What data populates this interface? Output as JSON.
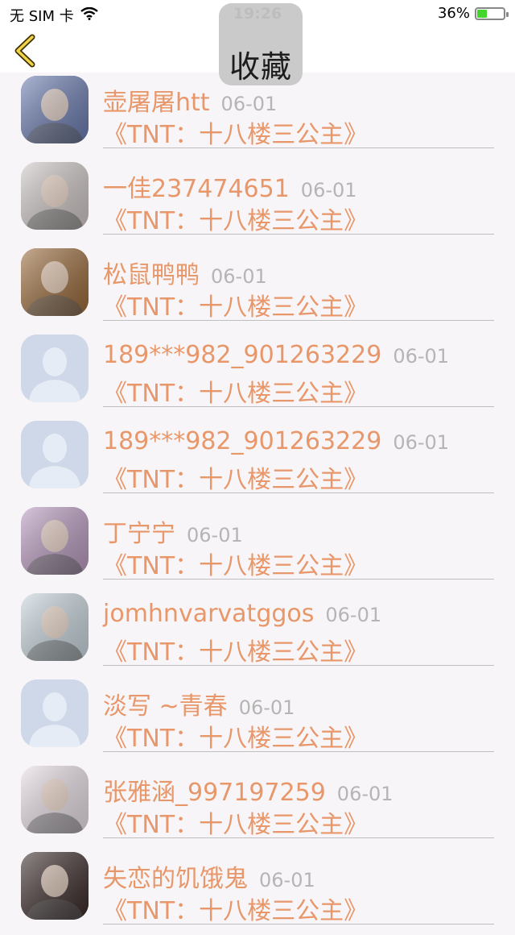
{
  "status_bar": {
    "carrier": "无 SIM 卡",
    "time": "19:26",
    "battery_percent_label": "36%",
    "battery_level": 0.36
  },
  "nav": {
    "title": "收藏",
    "back_icon": "chevron-left-icon"
  },
  "items": [
    {
      "name": "壶屠屠htt",
      "date": "06-01",
      "title": "《TNT：十八楼三公主》",
      "avatar": "photo",
      "avatar_color": "#6a7bb0"
    },
    {
      "name": "一佳237474651",
      "date": "06-01",
      "title": "《TNT：十八楼三公主》",
      "avatar": "photo",
      "avatar_color": "#cfc8c6"
    },
    {
      "name": "松鼠鸭鸭",
      "date": "06-01",
      "title": "《TNT：十八楼三公主》",
      "avatar": "photo",
      "avatar_color": "#9a6a3a"
    },
    {
      "name": "189***982_901263229",
      "date": "06-01",
      "title": "《TNT：十八楼三公主》",
      "avatar": "default",
      "avatar_color": "#cfd8e8"
    },
    {
      "name": "189***982_901263229",
      "date": "06-01",
      "title": "《TNT：十八楼三公主》",
      "avatar": "default",
      "avatar_color": "#cfd8e8"
    },
    {
      "name": "丁宁宁",
      "date": "06-01",
      "title": "《TNT：十八楼三公主》",
      "avatar": "photo",
      "avatar_color": "#b99bc0"
    },
    {
      "name": "jomhnvarvatggos",
      "date": "06-01",
      "title": "《TNT：十八楼三公主》",
      "avatar": "photo",
      "avatar_color": "#c9d6de"
    },
    {
      "name": "淡写 ~青春",
      "date": "06-01",
      "title": "《TNT：十八楼三公主》",
      "avatar": "default",
      "avatar_color": "#cfd8e8"
    },
    {
      "name": "张雅涵_997197259",
      "date": "06-01",
      "title": "《TNT：十八楼三公主》",
      "avatar": "photo",
      "avatar_color": "#e9dfe6"
    },
    {
      "name": "失恋的饥饿鬼",
      "date": "06-01",
      "title": "《TNT：十八楼三公主》",
      "avatar": "photo",
      "avatar_color": "#3a2a2a"
    }
  ]
}
